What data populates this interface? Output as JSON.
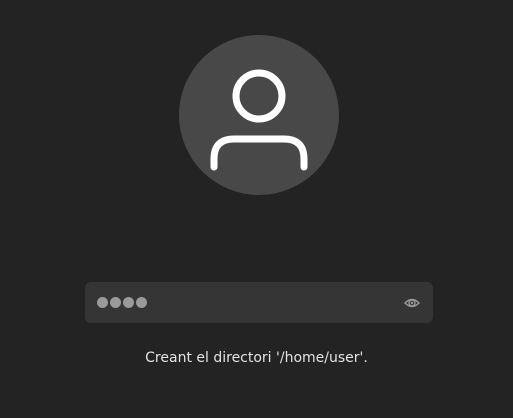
{
  "avatar": {
    "icon": "user-icon"
  },
  "password": {
    "masked_value": "••••",
    "reveal_icon": "eye-icon"
  },
  "status": {
    "message": "Creant el directori '/home/user'."
  },
  "colors": {
    "background": "#232323",
    "avatar_circle": "#484848",
    "avatar_glyph": "#ffffff",
    "field_background": "#353535",
    "dots": "#9a9a9a",
    "text": "#e3e3e3"
  }
}
